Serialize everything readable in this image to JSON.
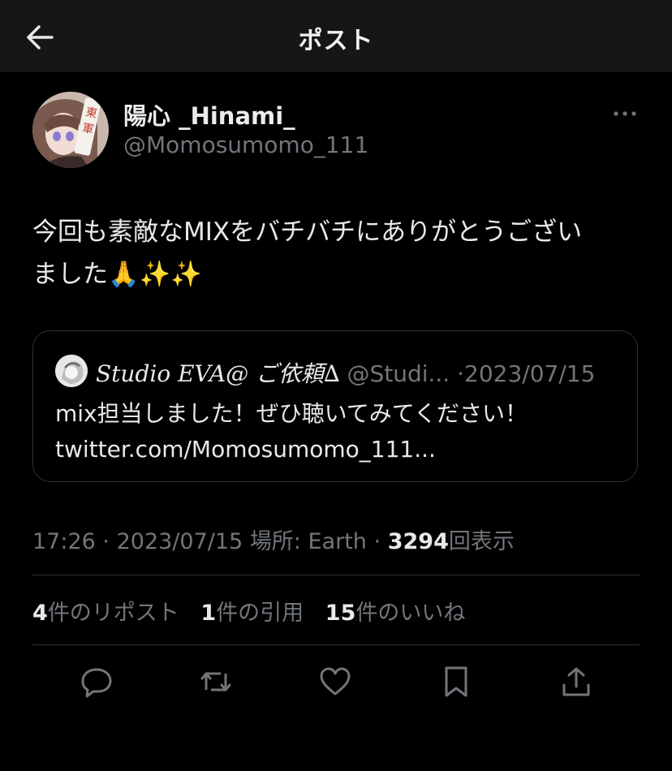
{
  "header": {
    "title": "ポスト",
    "back_icon": "back-arrow-icon"
  },
  "author": {
    "display_name": "陽心 _Hinami_",
    "handle": "@Momosumomo_111"
  },
  "post": {
    "text": "今回も素敵なMIXをバチバチにありがとうござい\nました🙏✨✨"
  },
  "quoted_post": {
    "display_name": "Studio EVA@ ご依頼∆",
    "handle": "@Studi...",
    "separator": "·",
    "date": "2023/07/15",
    "text": "mix担当しました！ぜひ聴いてみてください！\ntwitter.com/Momosumomo_111..."
  },
  "meta": {
    "time": "17:26",
    "sep1": "·",
    "date": "2023/07/15",
    "location_label": "場所:",
    "location": "Earth",
    "sep2": "·",
    "views_count": "3294",
    "views_label": "回表示"
  },
  "stats": {
    "reposts_count": "4",
    "reposts_label": "件のリポスト",
    "quotes_count": "1",
    "quotes_label": "件の引用",
    "likes_count": "15",
    "likes_label": "件のいいね"
  },
  "actions": [
    "reply-icon",
    "repost-icon",
    "like-icon",
    "bookmark-icon",
    "share-icon"
  ],
  "colors": {
    "background": "#000000",
    "topbar": "#161616",
    "secondary_text": "#71767b",
    "primary_text": "#e7e9ea",
    "divider": "#2f3336"
  }
}
